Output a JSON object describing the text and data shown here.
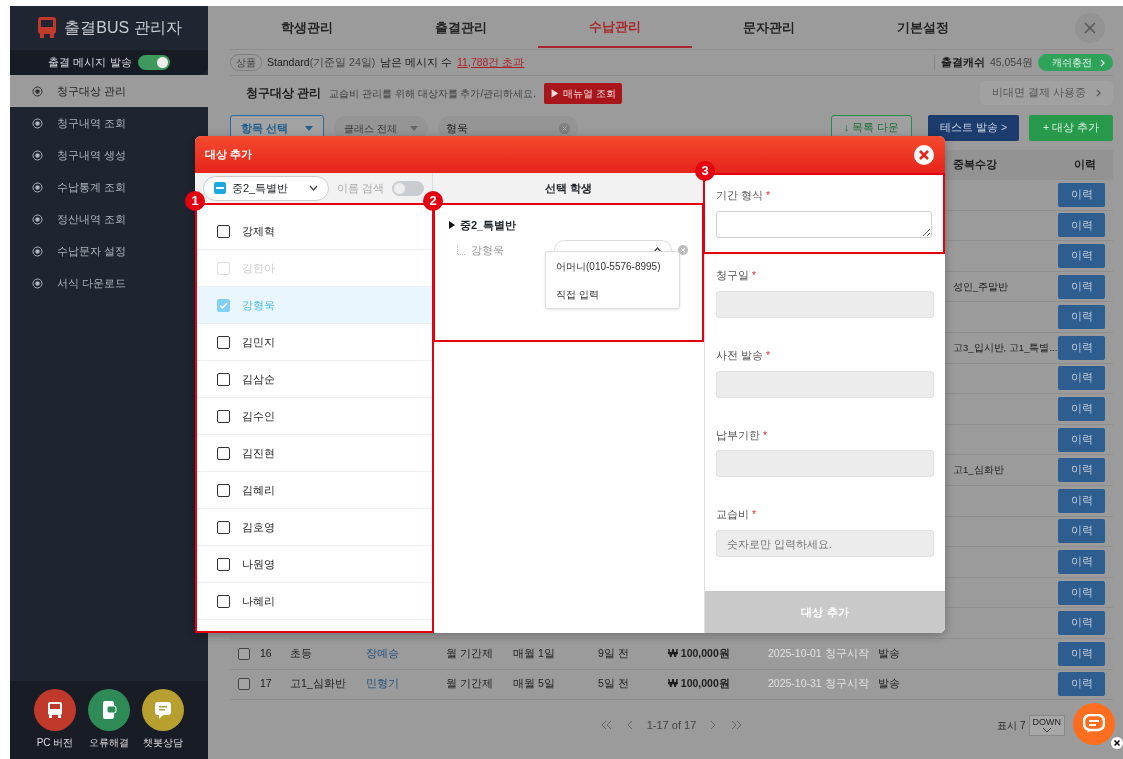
{
  "sidebar": {
    "logo": "출결BUS 관리자",
    "message_toggle": {
      "label": "출결 메시지 발송",
      "on": true
    },
    "items": [
      {
        "label": "청구대상 관리",
        "selected": true
      },
      {
        "label": "청구내역 조회",
        "selected": false
      },
      {
        "label": "청구내역 생성",
        "selected": false
      },
      {
        "label": "수납통계 조회",
        "selected": false
      },
      {
        "label": "정산내역 조회",
        "selected": false
      },
      {
        "label": "수납문자 설정",
        "selected": false
      },
      {
        "label": "서식 다운로드",
        "selected": false
      }
    ],
    "shortcuts": [
      {
        "label": "PC 버전",
        "kind": "bus",
        "color": "#c0392b"
      },
      {
        "label": "오류해결",
        "kind": "phone",
        "color": "#2e8b57"
      },
      {
        "label": "챗봇상담",
        "kind": "chat",
        "color": "#b8a030"
      }
    ]
  },
  "tabs": [
    {
      "label": "학생관리",
      "selected": false
    },
    {
      "label": "출결관리",
      "selected": false
    },
    {
      "label": "수납관리",
      "selected": true
    },
    {
      "label": "문자관리",
      "selected": false
    },
    {
      "label": "기본설정",
      "selected": false
    }
  ],
  "info_bar": {
    "badge": "상품",
    "plan": "Standard",
    "plan_note": "(기준일 24일)",
    "remaining_label": "남은 메시지 수",
    "remaining_link": "11,788건 초과",
    "cash_label": "출결캐쉬",
    "cash_amount": "45,054원",
    "cash_button": "캐쉬충전"
  },
  "page_header": {
    "title": "청구대상 관리",
    "description": "교습비 관리를 위해 대상자를 추가/관리하세요.",
    "manual_button": "▶ 매뉴얼 조회",
    "payment_button": "비대면 결제 사용중"
  },
  "filters": {
    "field_select": "항목 선택",
    "class_select": "클래스 전체",
    "search_value": "형욱",
    "download_button": "↓ 목록 다운",
    "test_button": "테스트 발송 >",
    "add_button": "+ 대상 추가"
  },
  "table": {
    "columns": [
      "중복수강",
      "이력"
    ],
    "rows": [
      {
        "duplicate": "",
        "button": "이력"
      },
      {
        "duplicate": "",
        "button": "이력"
      },
      {
        "duplicate": "",
        "button": "이력"
      },
      {
        "duplicate": "성인_주말반",
        "button": "이력"
      },
      {
        "duplicate": "",
        "button": "이력"
      },
      {
        "duplicate": "고3_입시반, 고1_특별...",
        "button": "이력"
      },
      {
        "duplicate": "",
        "button": "이력"
      },
      {
        "duplicate": "",
        "button": "이력"
      },
      {
        "duplicate": "",
        "button": "이력"
      },
      {
        "duplicate": "고1_심화반",
        "button": "이력"
      },
      {
        "duplicate": "",
        "button": "이력"
      },
      {
        "duplicate": "",
        "button": "이력"
      },
      {
        "duplicate": "",
        "button": "이력"
      },
      {
        "duplicate": "",
        "button": "이력"
      },
      {
        "duplicate": "",
        "button": "이력"
      },
      {
        "checked": false,
        "no": "16",
        "class": "초등",
        "name": "장예승",
        "type": "월 기간제",
        "billing_day": "매월 1일",
        "days": "9일 전",
        "amount": "₩ 100,000원",
        "start": "2025-10-01 청구시작",
        "status": "발송",
        "duplicate": "",
        "button": "이력"
      },
      {
        "checked": false,
        "no": "17",
        "class": "고1_심화반",
        "name": "민형기",
        "type": "월 기간제",
        "billing_day": "매월 5일",
        "days": "5일 전",
        "amount": "₩ 100,000원",
        "start": "2025-10-31 청구시작",
        "status": "발송",
        "duplicate": "",
        "button": "이력"
      }
    ]
  },
  "pagination": {
    "range": "1-17 of 17",
    "page_size_label": "표시 7",
    "page_size_value": "DOWN"
  },
  "modal": {
    "title": "대상 추가",
    "class_select": "중2_특별반",
    "name_search": {
      "label": "이름 검색",
      "on": false
    },
    "students": [
      {
        "name": "강제혁",
        "checked": false,
        "disabled": false,
        "selected": false
      },
      {
        "name": "강한아",
        "checked": false,
        "disabled": true,
        "selected": false
      },
      {
        "name": "강형욱",
        "checked": true,
        "disabled": false,
        "selected": true
      },
      {
        "name": "김민지",
        "checked": false,
        "disabled": false,
        "selected": false
      },
      {
        "name": "김삼순",
        "checked": false,
        "disabled": false,
        "selected": false
      },
      {
        "name": "김수인",
        "checked": false,
        "disabled": false,
        "selected": false
      },
      {
        "name": "김진현",
        "checked": false,
        "disabled": false,
        "selected": false
      },
      {
        "name": "김혜리",
        "checked": false,
        "disabled": false,
        "selected": false
      },
      {
        "name": "김호영",
        "checked": false,
        "disabled": false,
        "selected": false
      },
      {
        "name": "나원영",
        "checked": false,
        "disabled": false,
        "selected": false
      },
      {
        "name": "나혜리",
        "checked": false,
        "disabled": false,
        "selected": false
      }
    ],
    "selected_header": "선택 학생",
    "selected_group": {
      "label": "중2_특별반",
      "expanded": true,
      "children": [
        {
          "name": "강형욱",
          "options": [
            "어머니(010-5576-8995)",
            "직접 입력"
          ]
        }
      ]
    },
    "form": [
      {
        "label": "기간 형식",
        "required_mark": "*",
        "kind": "textarea",
        "disabled": false
      },
      {
        "label": "청구일",
        "required_mark": "*",
        "kind": "input",
        "disabled": true
      },
      {
        "label": "사전 발송",
        "required_mark": "*",
        "kind": "input",
        "disabled": true
      },
      {
        "label": "납부기한",
        "required_mark": "*",
        "kind": "input",
        "disabled": true
      },
      {
        "label": "교습비",
        "required_mark": "*",
        "kind": "input",
        "disabled": true,
        "placeholder": "숫자로만 입력하세요."
      }
    ],
    "submit_button": {
      "label": "대상 추가",
      "disabled": true
    },
    "annotations": [
      "1",
      "2",
      "3"
    ]
  }
}
